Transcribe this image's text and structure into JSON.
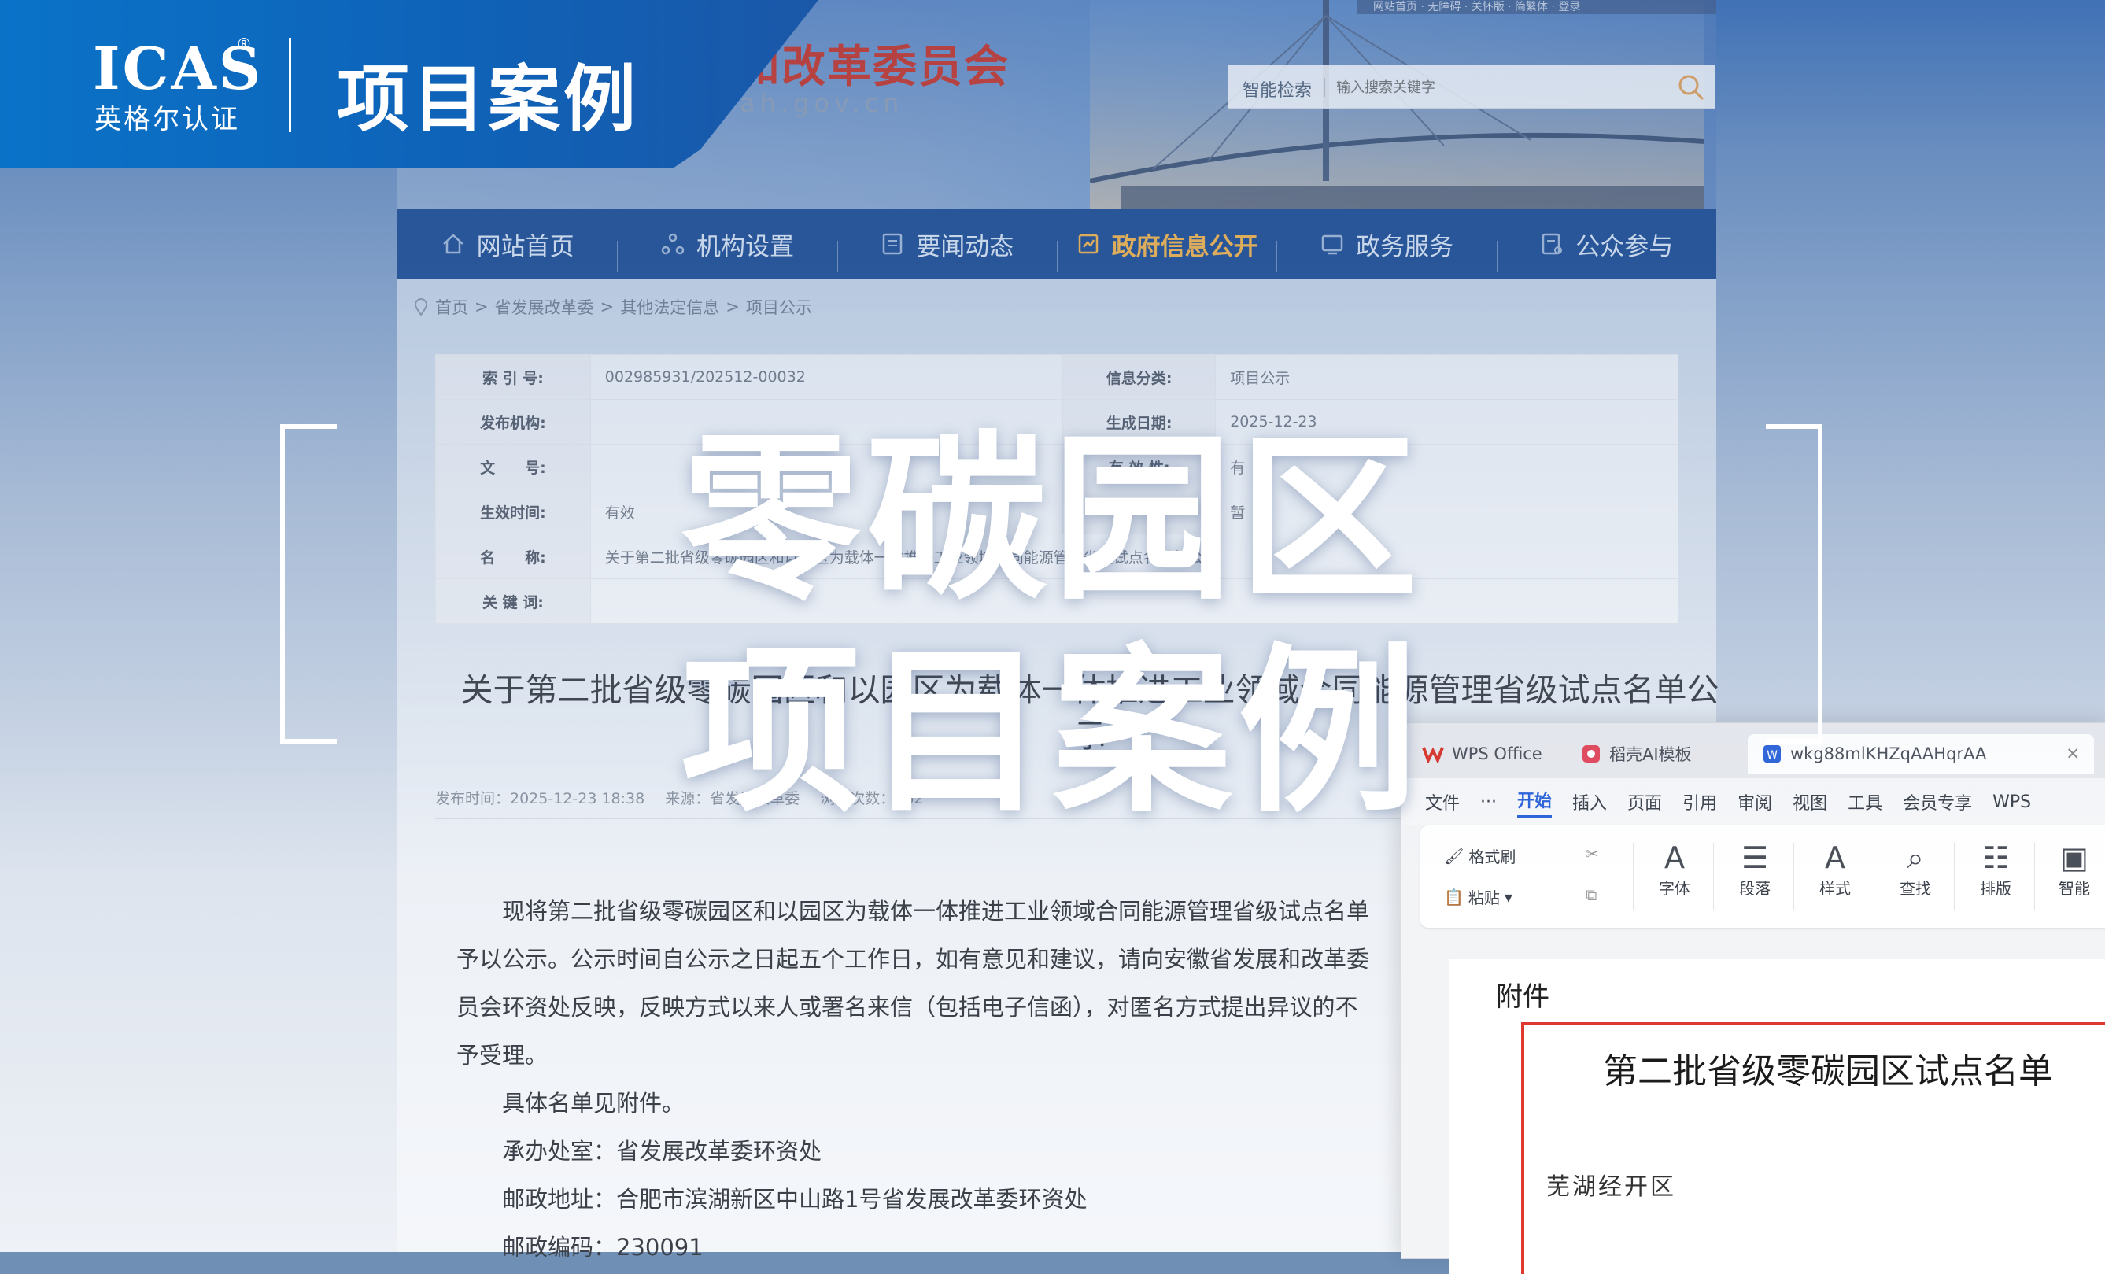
{
  "banner": {
    "logo_text": "ICAS",
    "logo_reg": "®",
    "logo_subtitle": "英格尔认证",
    "title": "项目案例"
  },
  "hero": {
    "line1": "零碳园区",
    "line2": "项目案例"
  },
  "site": {
    "title": "和改革委员会",
    "domain": "ah.gov.cn",
    "top_links": "网站首页 · 无障碍 · 关怀版 · 简繁体 · 登录",
    "search": {
      "label": "智能检索",
      "placeholder": "输入搜索关键字"
    },
    "nav": [
      {
        "label": "网站首页",
        "icon": "home-icon"
      },
      {
        "label": "机构设置",
        "icon": "org-icon"
      },
      {
        "label": "要闻动态",
        "icon": "news-icon"
      },
      {
        "label": "政府信息公开",
        "icon": "info-open-icon"
      },
      {
        "label": "政务服务",
        "icon": "service-icon"
      },
      {
        "label": "公众参与",
        "icon": "participate-icon"
      }
    ],
    "breadcrumb": [
      "首页",
      "省发展改革委",
      "其他法定信息",
      "项目公示"
    ],
    "meta": {
      "index_no_label": "索 引 号:",
      "index_no": "002985931/202512-00032",
      "category_label": "信息分类:",
      "category": "项目公示",
      "publisher_label": "发布机构:",
      "publisher": "",
      "created_label": "生成日期:",
      "created": "2025-12-23",
      "doc_no_label": "文　　号:",
      "doc_no": "",
      "valid_label": "有 效 性:",
      "valid": "有",
      "effective_label": "生效时间:",
      "effective": "有效",
      "extra_label": "",
      "extra": "暂",
      "name_label": "名　　称:",
      "name": "关于第二批省级零碳园区和以园区为载体一体推进工业领域合同能源管理省级试点名单的公示",
      "keywords_label": "关 键 词:",
      "keywords": ""
    },
    "doc_title": "关于第二批省级零碳园区和以园区为载体一体推进工业领域合同能源管理省级试点名单公示",
    "pub": {
      "time": "发布时间：2025-12-23 18:38",
      "source": "来源：省发展改革委",
      "views": "浏览次数：562"
    },
    "body": {
      "p1": "现将第二批省级零碳园区和以园区为载体一体推进工业领域合同能源管理省级试点名单予以公示。公示时间自公示之日起五个工作日，如有意见和建议，请向安徽省发展和改革委员会环资处反映，反映方式以来人或署名来信（包括电子信函），对匿名方式提出异议的不予受理。",
      "p2": "具体名单见附件。",
      "p3": "承办处室：省发展改革委环资处",
      "p4": "邮政地址：合肥市滨湖新区中山路1号省发展改革委环资处",
      "p5": "邮政编码：230091"
    }
  },
  "wps": {
    "tabs": [
      {
        "label": "WPS Office",
        "icon": "wps-logo-icon"
      },
      {
        "label": "稻壳AI模板",
        "icon": "docer-icon"
      },
      {
        "label": "wkg88mlKHZqAAHqrAA",
        "icon": "doc-icon"
      }
    ],
    "menu": [
      "文件",
      "···",
      "开始",
      "插入",
      "页面",
      "引用",
      "审阅",
      "视图",
      "工具",
      "会员专享",
      "WPS"
    ],
    "active_menu": "开始",
    "ribbon": {
      "format_painter": "格式刷",
      "paste": "粘贴",
      "font": "字体",
      "paragraph": "段落",
      "style": "样式",
      "find": "查找",
      "layout": "排版",
      "smart": "智能"
    },
    "doc": {
      "attachment": "附件",
      "list_title": "第二批省级零碳园区试点名单",
      "first_item": "芜湖经开区"
    }
  }
}
